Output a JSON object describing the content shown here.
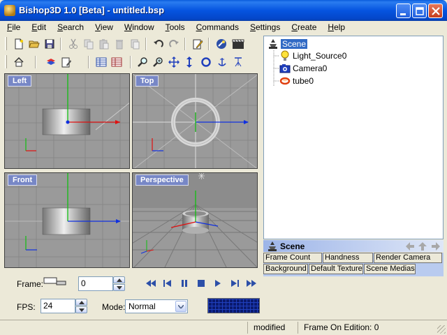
{
  "window": {
    "title": "Bishop3D 1.0 [Beta] - untitled.bsp"
  },
  "menu": [
    {
      "label": "File",
      "u": "F",
      "rest": "ile"
    },
    {
      "label": "Edit",
      "u": "E",
      "rest": "dit"
    },
    {
      "label": "Search",
      "u": "S",
      "rest": "earch"
    },
    {
      "label": "View",
      "u": "V",
      "rest": "iew"
    },
    {
      "label": "Window",
      "u": "W",
      "rest": "indow"
    },
    {
      "label": "Tools",
      "u": "T",
      "rest": "ools"
    },
    {
      "label": "Commands",
      "u": "C",
      "rest": "ommands"
    },
    {
      "label": "Settings",
      "u": "S",
      "rest": "ettings"
    },
    {
      "label": "Create",
      "u": "C",
      "rest": "reate"
    },
    {
      "label": "Help",
      "u": "H",
      "rest": "elp"
    }
  ],
  "viewports": {
    "left": "Left",
    "top": "Top",
    "front": "Front",
    "perspective": "Perspective"
  },
  "tree": {
    "root": "Scene",
    "children": [
      "Light_Source0",
      "Camera0",
      "tube0"
    ]
  },
  "properties": {
    "title": "Scene",
    "tabs_row1": [
      "Frame Count",
      "Handness",
      "Render Camera"
    ],
    "tabs_row2": [
      "Background",
      "Default Texture",
      "Scene Medias"
    ]
  },
  "controls": {
    "frame_label": "Frame:",
    "frame_value": "0",
    "fps_label": "FPS:",
    "fps_value": "24",
    "mode_label": "Mode:",
    "mode_value": "Normal"
  },
  "status": {
    "state": "modified",
    "frame_on_edition": "Frame On Edition: 0"
  },
  "colors": {
    "titlebar": "#0554e0",
    "viewport_label": "#7787c6",
    "axis_x": "#e01010",
    "axis_y": "#10c010",
    "axis_z": "#1030e0",
    "selection": "#316ac5"
  }
}
